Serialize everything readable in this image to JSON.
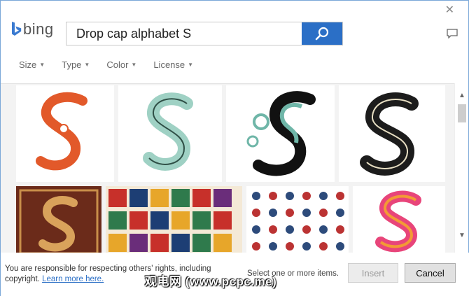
{
  "window": {
    "close_glyph": "✕"
  },
  "logo": {
    "text": "bing"
  },
  "search": {
    "value": "Drop cap alphabet S"
  },
  "filters": [
    {
      "label": "Size"
    },
    {
      "label": "Type"
    },
    {
      "label": "Color"
    },
    {
      "label": "License"
    }
  ],
  "results": [
    {
      "title": "Orange ornamental S",
      "colors": [
        "#e2592a",
        "#ffffff"
      ]
    },
    {
      "title": "Mint green striped S",
      "colors": [
        "#9fd1c4",
        "#2f4f46"
      ]
    },
    {
      "title": "Teal and black flourished S",
      "colors": [
        "#111111",
        "#6fb6a8"
      ]
    },
    {
      "title": "Black and cream striped S",
      "colors": [
        "#1c1c1c",
        "#e8dfc3"
      ]
    },
    {
      "title": "Engraved ornate S",
      "colors": [
        "#6b2b1a",
        "#c98f4a"
      ]
    },
    {
      "title": "Decorative alphabet sheet",
      "colors": [
        "#c7302a",
        "#1d3e74"
      ]
    },
    {
      "title": "Illuminated alphabet set",
      "colors": [
        "#2d4b7b",
        "#b33"
      ]
    },
    {
      "title": "Pink and orange S",
      "colors": [
        "#e8457a",
        "#f39a35"
      ]
    }
  ],
  "footer": {
    "notice_text": "You are responsible for respecting others' rights, including copyright.",
    "learn_more": "Learn more here.",
    "select_hint": "Select one or more items.",
    "insert_label": "Insert",
    "cancel_label": "Cancel"
  },
  "watermark": {
    "text": "观电网 (www.pcpc.me)"
  }
}
